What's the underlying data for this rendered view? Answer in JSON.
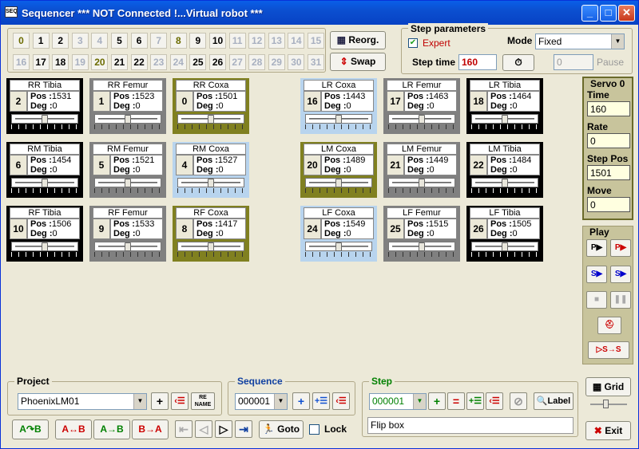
{
  "window": {
    "title": "Sequencer   *** NOT Connected !...Virtual robot ***",
    "icon_text": "SEQ"
  },
  "tiles_row1": [
    {
      "n": "0",
      "s": "green"
    },
    {
      "n": "1",
      "s": "n"
    },
    {
      "n": "2",
      "s": "n"
    },
    {
      "n": "3",
      "s": "dim"
    },
    {
      "n": "4",
      "s": "dim"
    },
    {
      "n": "5",
      "s": "n"
    },
    {
      "n": "6",
      "s": "n"
    },
    {
      "n": "7",
      "s": "dim"
    },
    {
      "n": "8",
      "s": "green"
    },
    {
      "n": "9",
      "s": "n"
    },
    {
      "n": "10",
      "s": "n"
    },
    {
      "n": "11",
      "s": "dim"
    },
    {
      "n": "12",
      "s": "dim"
    },
    {
      "n": "13",
      "s": "dim"
    },
    {
      "n": "14",
      "s": "dim"
    },
    {
      "n": "15",
      "s": "dim"
    }
  ],
  "tiles_row2": [
    {
      "n": "16",
      "s": "dim"
    },
    {
      "n": "17",
      "s": "n"
    },
    {
      "n": "18",
      "s": "n"
    },
    {
      "n": "19",
      "s": "dim"
    },
    {
      "n": "20",
      "s": "green"
    },
    {
      "n": "21",
      "s": "n"
    },
    {
      "n": "22",
      "s": "n"
    },
    {
      "n": "23",
      "s": "dim"
    },
    {
      "n": "24",
      "s": "dim"
    },
    {
      "n": "25",
      "s": "n"
    },
    {
      "n": "26",
      "s": "n"
    },
    {
      "n": "27",
      "s": "dim"
    },
    {
      "n": "28",
      "s": "dim"
    },
    {
      "n": "29",
      "s": "dim"
    },
    {
      "n": "30",
      "s": "dim"
    },
    {
      "n": "31",
      "s": "dim"
    }
  ],
  "tool": {
    "reorg": "Reorg.",
    "swap": "Swap"
  },
  "step_params": {
    "title": "Step parameters",
    "expert": "Expert",
    "expert_checked": true,
    "mode_label": "Mode",
    "mode_value": "Fixed",
    "step_time_label": "Step time",
    "step_time_value": "160",
    "pause_value": "0",
    "pause_label": "Pause"
  },
  "servo_panel": {
    "title": "Servo 0",
    "time_label": "Time",
    "time": "160",
    "rate_label": "Rate",
    "rate": "0",
    "steppos_label": "Step Pos",
    "steppos": "1501",
    "move_label": "Move",
    "move": "0"
  },
  "play": {
    "title": "Play"
  },
  "servos": [
    {
      "name": "RR Tibia",
      "num": "2",
      "pos": "1531",
      "deg": "0",
      "theme": "black",
      "level": 0.5
    },
    {
      "name": "RR Femur",
      "num": "1",
      "pos": "1523",
      "deg": "0",
      "theme": "gray",
      "level": 0.5
    },
    {
      "name": "RR Coxa",
      "num": "0",
      "pos": "1501",
      "deg": "0",
      "theme": "olive",
      "level": 0.5
    },
    {
      "name": "LR Coxa",
      "num": "16",
      "pos": "1443",
      "deg": "0",
      "theme": "blue",
      "level": 0.5
    },
    {
      "name": "LR Femur",
      "num": "17",
      "pos": "1463",
      "deg": "0",
      "theme": "gray",
      "level": 0.5
    },
    {
      "name": "LR Tibia",
      "num": "18",
      "pos": "1464",
      "deg": "0",
      "theme": "black",
      "level": 0.5
    },
    {
      "name": "RM Tibia",
      "num": "6",
      "pos": "1454",
      "deg": "0",
      "theme": "black",
      "level": 0.5
    },
    {
      "name": "RM Femur",
      "num": "5",
      "pos": "1521",
      "deg": "0",
      "theme": "gray",
      "level": 0.5
    },
    {
      "name": "RM Coxa",
      "num": "4",
      "pos": "1527",
      "deg": "0",
      "theme": "blue",
      "level": 0.5
    },
    {
      "name": "LM Coxa",
      "num": "20",
      "pos": "1489",
      "deg": "0",
      "theme": "olive",
      "level": 0.5
    },
    {
      "name": "LM Femur",
      "num": "21",
      "pos": "1449",
      "deg": "0",
      "theme": "gray",
      "level": 0.5
    },
    {
      "name": "LM Tibia",
      "num": "22",
      "pos": "1484",
      "deg": "0",
      "theme": "black",
      "level": 0.5
    },
    {
      "name": "RF Tibia",
      "num": "10",
      "pos": "1506",
      "deg": "0",
      "theme": "black",
      "level": 0.5
    },
    {
      "name": "RF Femur",
      "num": "9",
      "pos": "1533",
      "deg": "0",
      "theme": "gray",
      "level": 0.5
    },
    {
      "name": "RF Coxa",
      "num": "8",
      "pos": "1417",
      "deg": "0",
      "theme": "olive",
      "level": 0.5
    },
    {
      "name": "LF Coxa",
      "num": "24",
      "pos": "1549",
      "deg": "0",
      "theme": "blue",
      "level": 0.5
    },
    {
      "name": "LF Femur",
      "num": "25",
      "pos": "1515",
      "deg": "0",
      "theme": "gray",
      "level": 0.5
    },
    {
      "name": "LF Tibia",
      "num": "26",
      "pos": "1505",
      "deg": "0",
      "theme": "black",
      "level": 0.5
    }
  ],
  "labels": {
    "pos": "Pos :",
    "deg": "Deg :"
  },
  "project": {
    "title": "Project",
    "value": "PhoenixLM01",
    "rename": "RE NAME"
  },
  "sequence": {
    "title": "Sequence",
    "value": "000001"
  },
  "step": {
    "title": "Step",
    "value": "000001",
    "label_btn": "Label",
    "comment": "Flip box"
  },
  "bottom": {
    "goto": "Goto",
    "lock": "Lock",
    "grid": "Grid",
    "exit": "Exit",
    "ab1": "A↷B",
    "ab2": "A↔B",
    "ab3": "A→B",
    "ab4": "B→A"
  },
  "colors": {
    "black": "#000000",
    "gray": "#808080",
    "olive": "#808020",
    "blue": "#b8d4ee",
    "green_text": "#008000",
    "blue_text": "#0000c0",
    "red": "#c00000"
  }
}
